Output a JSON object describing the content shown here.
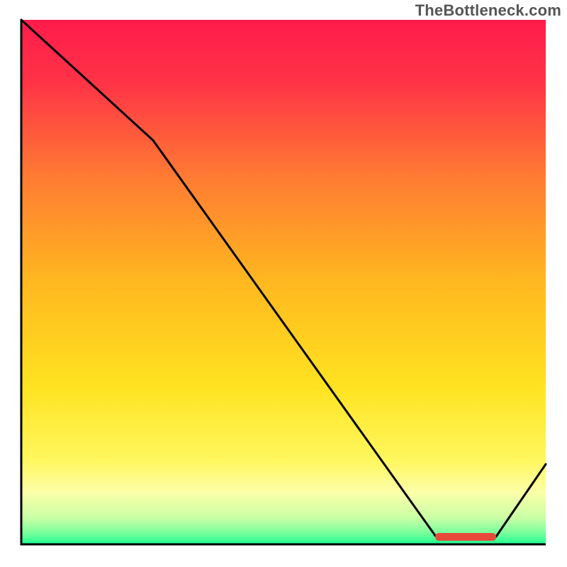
{
  "watermark": "TheBottleneck.com",
  "colors": {
    "line": "#000000",
    "axes": "#000000",
    "marker": "#e84a3a",
    "gradient_top": "#ff1b4b",
    "gradient_mid": "#ffe321",
    "gradient_bottom": "#1bff90"
  },
  "chart_data": {
    "type": "line",
    "title": "",
    "xlabel": "",
    "ylabel": "",
    "xlim": [
      0,
      100
    ],
    "ylim": [
      0,
      100
    ],
    "grid": false,
    "legend": false,
    "series": [
      {
        "name": "curve",
        "x": [
          0,
          25,
          79,
          90,
          100
        ],
        "y": [
          100,
          77,
          1.5,
          1.5,
          15
        ]
      }
    ],
    "annotations": [
      {
        "name": "marker-chip",
        "x_range": [
          79,
          90
        ],
        "y": 1.5,
        "color": "#e84a3a"
      }
    ],
    "background_gradient": {
      "direction": "vertical",
      "stops": [
        {
          "pos": 0.0,
          "color": "#ff1b4b"
        },
        {
          "pos": 0.3,
          "color": "#ff7b33"
        },
        {
          "pos": 0.7,
          "color": "#ffe321"
        },
        {
          "pos": 0.95,
          "color": "#c9ffa5"
        },
        {
          "pos": 1.0,
          "color": "#1bff90"
        }
      ]
    }
  }
}
